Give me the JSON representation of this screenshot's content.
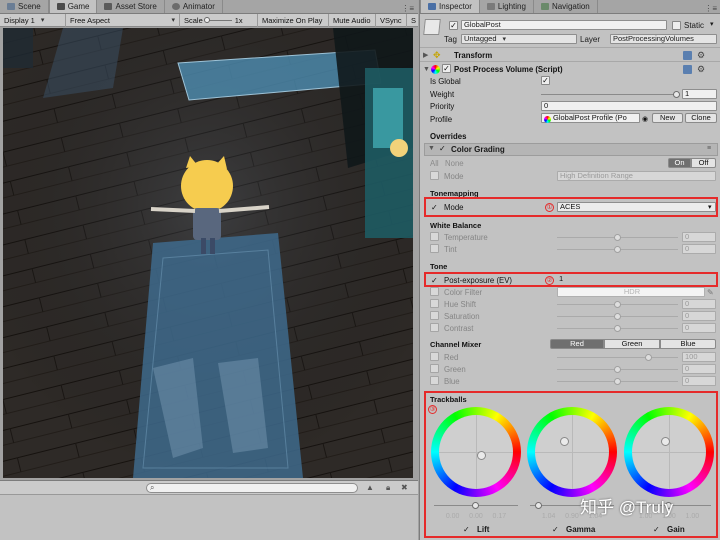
{
  "left_tabs": [
    {
      "label": "Scene",
      "icon": "scene-icon",
      "active": false
    },
    {
      "label": "Game",
      "icon": "game-icon",
      "active": true
    },
    {
      "label": "Asset Store",
      "icon": "asset-store-icon",
      "active": false
    },
    {
      "label": "Animator",
      "icon": "animator-icon",
      "active": false
    }
  ],
  "game_toolbar": {
    "display": "Display 1",
    "aspect": "Free Aspect",
    "scale_label": "Scale",
    "scale_value": "1x",
    "maximize": "Maximize On Play",
    "mute": "Mute Audio",
    "vsync": "VSync",
    "stats": "S"
  },
  "right_tabs": [
    {
      "label": "Inspector",
      "icon": "inspector-icon",
      "active": true
    },
    {
      "label": "Lighting",
      "icon": "lighting-icon",
      "active": false
    },
    {
      "label": "Navigation",
      "icon": "navigation-icon",
      "active": false
    }
  ],
  "object": {
    "name": "GlobalPost",
    "static_label": "Static",
    "tag_label": "Tag",
    "tag_value": "Untagged",
    "layer_label": "Layer",
    "layer_value": "PostProcessingVolumes"
  },
  "transform": {
    "title": "Transform"
  },
  "ppv": {
    "title": "Post Process Volume (Script)",
    "is_global_label": "Is Global",
    "weight_label": "Weight",
    "weight_value": "1",
    "weight_fraction": 1.0,
    "priority_label": "Priority",
    "priority_value": "0",
    "profile_label": "Profile",
    "profile_value": "GlobalPost Profile (Po",
    "new_button": "New",
    "clone_button": "Clone"
  },
  "overrides_label": "Overrides",
  "color_grading": {
    "title": "Color Grading",
    "all_label": "All",
    "none_label": "None",
    "on_label": "On",
    "off_label": "Off",
    "mode_label": "Mode",
    "mode_value": "High Definition Range",
    "tonemapping_section": "Tonemapping",
    "tm_mode_label": "Mode",
    "tm_mode_value": "ACES",
    "white_balance_section": "White Balance",
    "temperature_label": "Temperature",
    "temperature_value": "0",
    "tint_label": "Tint",
    "tint_value": "0",
    "tone_section": "Tone",
    "post_exposure_label": "Post-exposure (EV)",
    "post_exposure_value": "1",
    "color_filter_label": "Color Filter",
    "color_filter_value": "HDR",
    "hue_shift_label": "Hue Shift",
    "hue_shift_value": "0",
    "saturation_label": "Saturation",
    "saturation_value": "0",
    "contrast_label": "Contrast",
    "contrast_value": "0",
    "channel_mixer_section": "Channel Mixer",
    "channel_tabs": [
      "Red",
      "Green",
      "Blue"
    ],
    "mixer_red_label": "Red",
    "mixer_red_value": "100",
    "mixer_green_label": "Green",
    "mixer_green_value": "0",
    "mixer_blue_label": "Blue",
    "mixer_blue_value": "0",
    "trackballs_section": "Trackballs",
    "trackballs": [
      {
        "label": "Lift",
        "values": "0.00     0.00     0.17"
      },
      {
        "label": "Gamma",
        "values": "1.04     0.90     1.04"
      },
      {
        "label": "Gain",
        "values": "1.00     1.00     1.00"
      }
    ]
  },
  "callouts": [
    "①",
    "②",
    "③"
  ],
  "watermark": "知乎 @Truly",
  "colors": {
    "highlight": "#e52a2a",
    "accent_blue": "#3d7bd9"
  }
}
